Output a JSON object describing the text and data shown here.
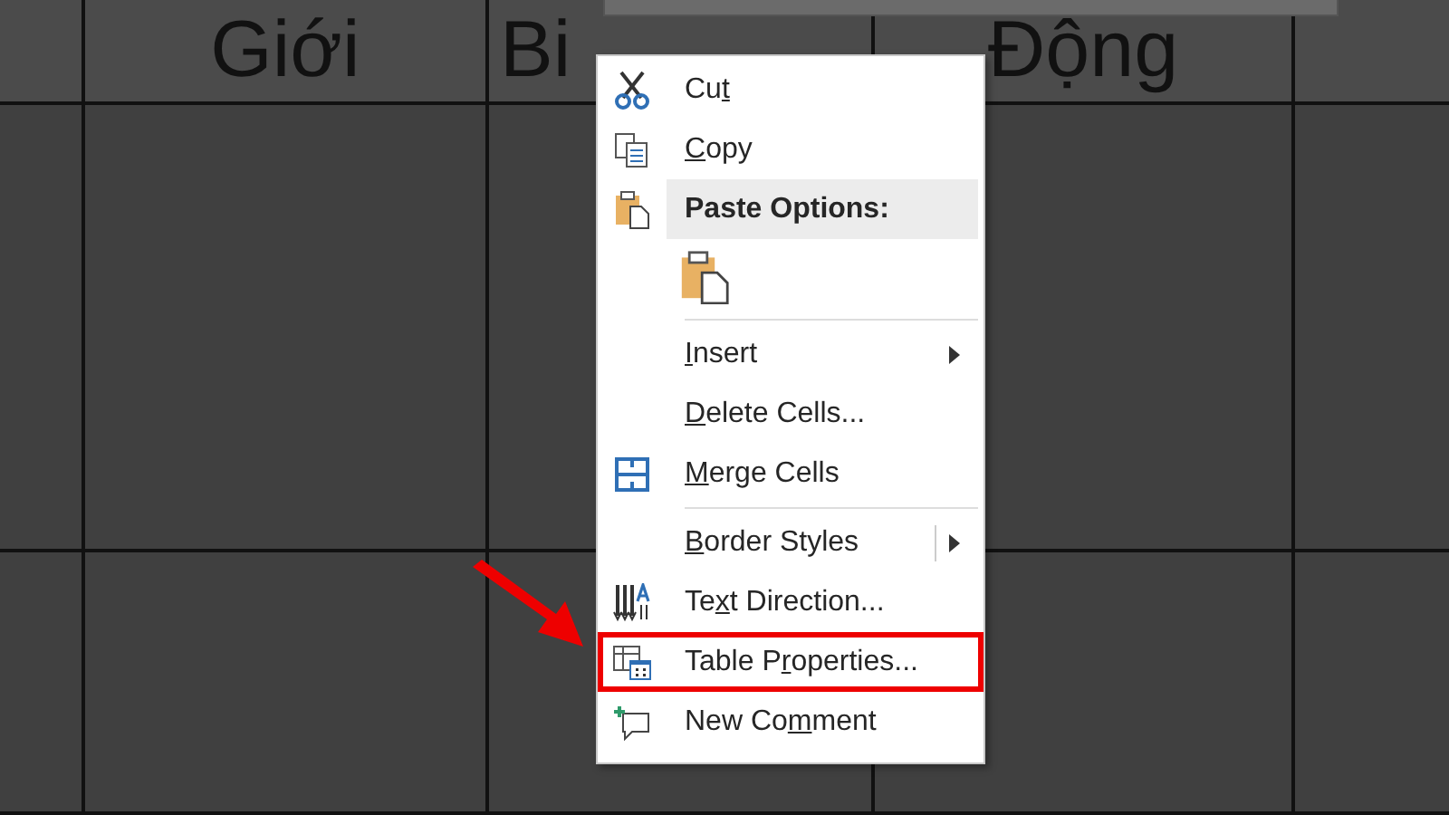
{
  "table": {
    "headers": [
      "Giới",
      "Bi",
      "Động"
    ]
  },
  "context_menu": {
    "items": [
      {
        "kind": "command",
        "label": {
          "before": "Cu",
          "key": "t"
        },
        "submenu": false,
        "split": false,
        "annotated": false
      },
      {
        "kind": "command",
        "label": {
          "key": "C",
          "after": "opy"
        },
        "submenu": false,
        "split": false,
        "annotated": false
      },
      {
        "kind": "heading",
        "label": {
          "before": "Paste Options:"
        }
      },
      {
        "kind": "paste-buttons"
      },
      {
        "kind": "separator"
      },
      {
        "kind": "command",
        "label": {
          "key": "I",
          "after": "nsert"
        },
        "submenu": true,
        "split": false,
        "annotated": false
      },
      {
        "kind": "command",
        "label": {
          "key": "D",
          "after": "elete Cells..."
        },
        "submenu": false,
        "split": false,
        "annotated": false
      },
      {
        "kind": "command",
        "label": {
          "key": "M",
          "after": "erge Cells"
        },
        "submenu": false,
        "split": false,
        "annotated": false
      },
      {
        "kind": "separator"
      },
      {
        "kind": "command",
        "label": {
          "key": "B",
          "after": "order Styles"
        },
        "submenu": true,
        "split": true,
        "annotated": false
      },
      {
        "kind": "command",
        "label": {
          "before": "Te",
          "key": "x",
          "after": "t Direction..."
        },
        "submenu": false,
        "split": false,
        "annotated": false
      },
      {
        "kind": "command",
        "label": {
          "before": "Table P",
          "key": "r",
          "after": "operties..."
        },
        "submenu": false,
        "split": false,
        "annotated": true
      },
      {
        "kind": "command",
        "label": {
          "before": "New Co",
          "key": "m",
          "after": "ment"
        },
        "submenu": false,
        "split": false,
        "annotated": false
      }
    ]
  }
}
